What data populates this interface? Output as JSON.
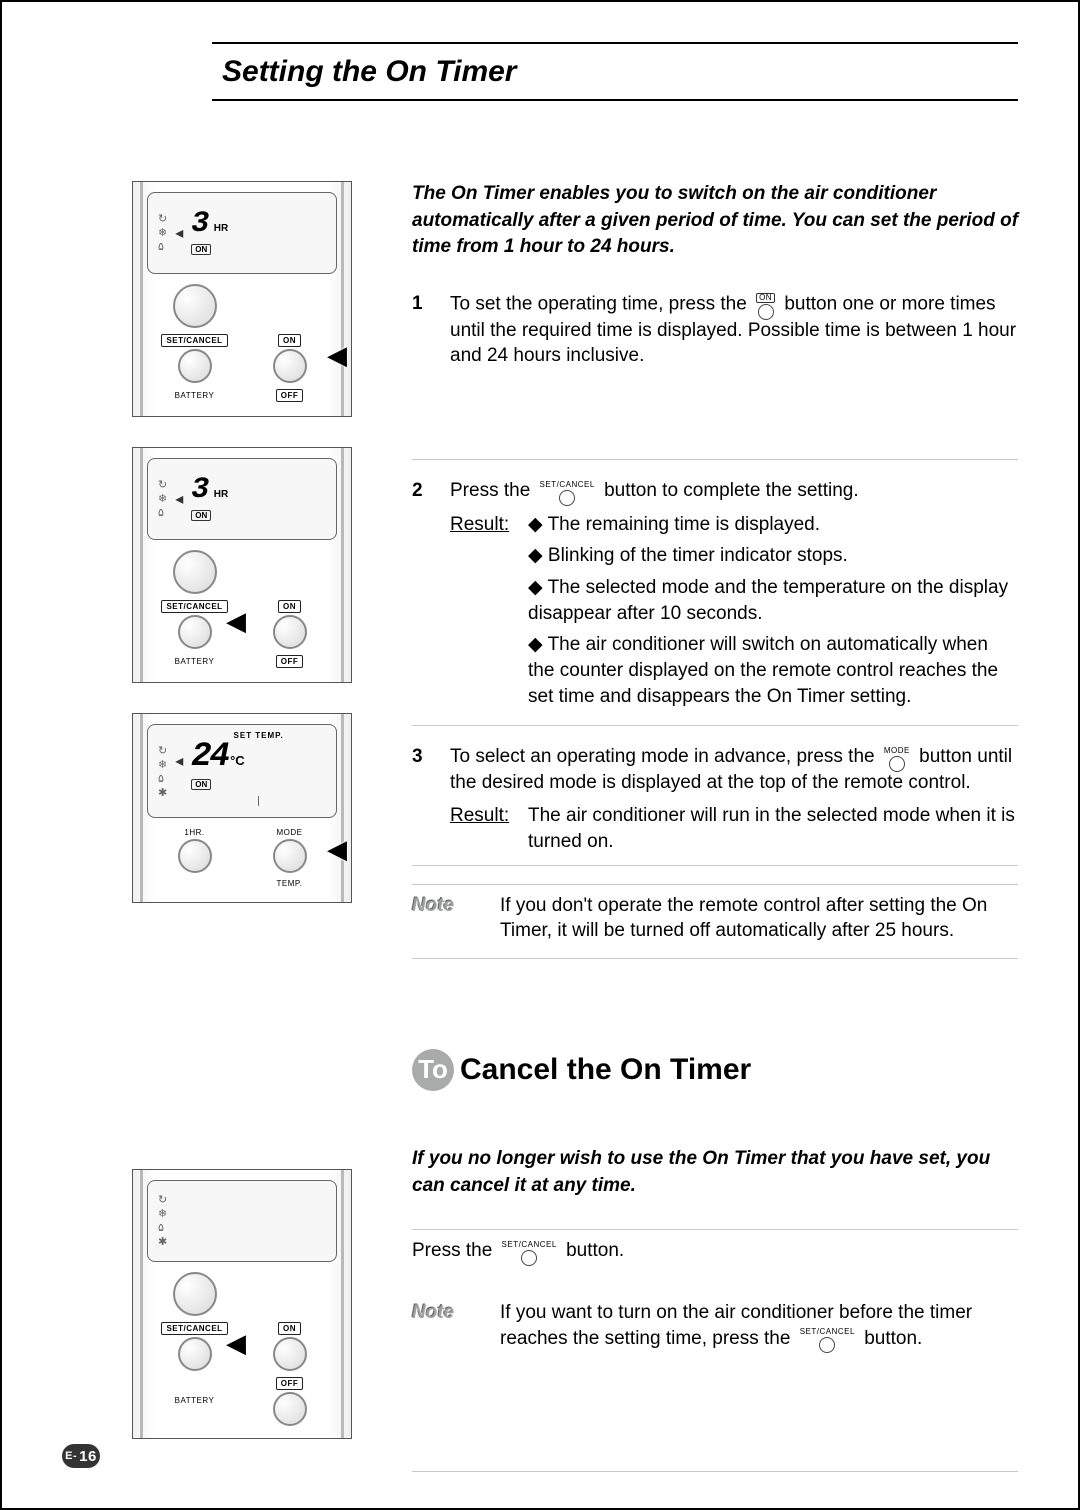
{
  "page_title": "Setting the On Timer",
  "intro": "The On Timer enables you to switch on the air conditioner automatically after a given period of time. You can set the period of time from 1 hour to 24 hours.",
  "steps": [
    {
      "num": "1",
      "text_a": "To set the operating time, press the ",
      "btn_label": "ON",
      "btn_boxed": true,
      "text_b": " button one or more times until the required time is displayed. Possible time is between 1 hour and 24 hours inclusive."
    },
    {
      "num": "2",
      "text_a": "Press the ",
      "btn_label": "SET/CANCEL",
      "btn_boxed": false,
      "text_b": " button to complete the setting.",
      "result_label": "Result:",
      "bullets": [
        "The remaining time is displayed.",
        "Blinking of the timer indicator stops.",
        "The selected mode and the temperature on the display disappear after 10 seconds.",
        "The air conditioner will switch on automatically when the counter displayed on the remote control reaches the set time and disappears the On Timer setting."
      ]
    },
    {
      "num": "3",
      "text_a": "To select an operating mode in advance, press the ",
      "btn_label": "MODE",
      "btn_boxed": false,
      "text_b": " button until the desired mode is displayed at the top of the remote control.",
      "result_label": "Result:",
      "result_text": "The air conditioner will run in the selected mode when it is turned on."
    }
  ],
  "note1": {
    "label": "Note",
    "text": "If you don't operate the remote control after setting the On Timer, it will be turned off automatically after 25 hours."
  },
  "sub_heading": {
    "lead": "To",
    "rest": " Cancel the On Timer"
  },
  "intro2": "If you no longer wish to use the On Timer that you have set, you can cancel it at any time.",
  "cancel": {
    "text_a": "Press the ",
    "btn_label": "SET/CANCEL",
    "text_b": " button."
  },
  "note2": {
    "label": "Note",
    "text_a": "If you want to turn on the air conditioner before the timer reaches the setting time, press the ",
    "btn_label": "SET/CANCEL",
    "text_b": " button."
  },
  "remotes": {
    "r1": {
      "value": "3",
      "unit": "HR",
      "tag": "ON",
      "labels": {
        "setcancel": "SET/CANCEL",
        "on": "ON",
        "off": "OFF",
        "battery": "BATTERY"
      }
    },
    "r2": {
      "value": "3",
      "unit": "HR",
      "tag": "ON",
      "labels": {
        "setcancel": "SET/CANCEL",
        "on": "ON",
        "off": "OFF",
        "battery": "BATTERY"
      }
    },
    "r3": {
      "toplabel": "SET TEMP.",
      "value": "24",
      "unit": "°C",
      "tag": "ON",
      "labels": {
        "1hr": "1HR.",
        "mode": "MODE",
        "temp": "TEMP."
      }
    },
    "r4": {
      "labels": {
        "setcancel": "SET/CANCEL",
        "on": "ON",
        "off": "OFF",
        "battery": "BATTERY"
      }
    }
  },
  "page_number": {
    "prefix": "E-",
    "num": "16"
  }
}
